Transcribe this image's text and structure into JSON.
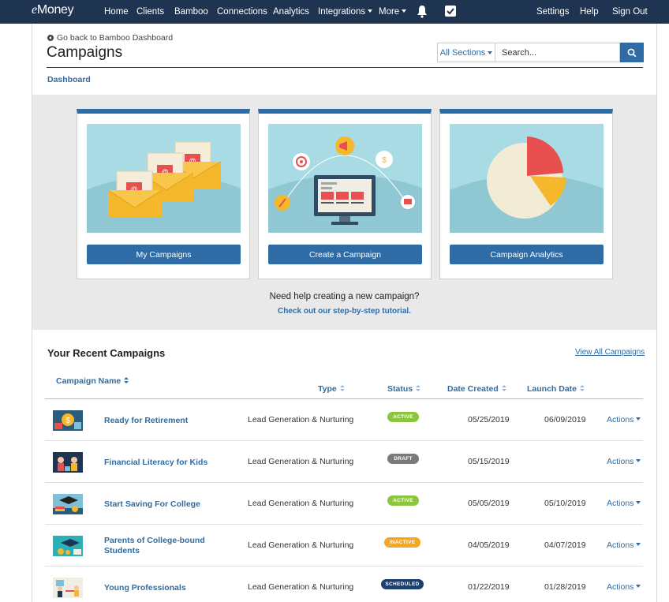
{
  "nav": {
    "logo_prefix": "e",
    "logo_rest": "Money",
    "items": [
      "Home",
      "Clients",
      "Bamboo",
      "Connections",
      "Analytics",
      "Integrations",
      "More"
    ],
    "right_items": [
      "Settings",
      "Help",
      "Sign Out"
    ],
    "bell_icon": "bell-icon",
    "check_icon": "checkbox-icon"
  },
  "header": {
    "back_link": "Go back to Bamboo Dashboard",
    "title": "Campaigns",
    "sections_label": "All Sections",
    "search_placeholder": "Search...",
    "breadcrumb": "Dashboard"
  },
  "cards": [
    {
      "button": "My Campaigns",
      "icon": "envelopes-illustration"
    },
    {
      "button": "Create a Campaign",
      "icon": "computer-illustration"
    },
    {
      "button": "Campaign Analytics",
      "icon": "pie-chart-illustration"
    }
  ],
  "help": {
    "text": "Need help creating a new campaign?",
    "link": "Check out our step-by-step tutorial."
  },
  "recent": {
    "title": "Your Recent Campaigns",
    "view_all": "View All Campaigns",
    "columns": {
      "name": "Campaign Name",
      "type": "Type",
      "status": "Status",
      "created": "Date Created",
      "launch": "Launch Date"
    },
    "rows": [
      {
        "name": "Ready for Retirement",
        "type": "Lead Generation & Nurturing",
        "status": "ACTIVE",
        "created": "05/25/2019",
        "launch": "06/09/2019",
        "actions": "Actions"
      },
      {
        "name": "Financial Literacy for Kids",
        "type": "Lead Generation & Nurturing",
        "status": "DRAFT",
        "created": "05/15/2019",
        "launch": "",
        "actions": "Actions"
      },
      {
        "name": "Start Saving For College",
        "type": "Lead Generation & Nurturing",
        "status": "ACTIVE",
        "created": "05/05/2019",
        "launch": "05/10/2019",
        "actions": "Actions"
      },
      {
        "name": "Parents of College-bound Students",
        "type": "Lead Generation & Nurturing",
        "status": "INACTIVE",
        "created": "04/05/2019",
        "launch": "04/07/2019",
        "actions": "Actions"
      },
      {
        "name": "Young Professionals",
        "type": "Lead Generation & Nurturing",
        "status": "SCHEDULED",
        "created": "01/22/2019",
        "launch": "01/28/2019",
        "actions": "Actions"
      }
    ]
  },
  "colors": {
    "nav_bg": "#1f3450",
    "accent": "#2f6ca5",
    "active": "#8cc63f",
    "draft": "#7a7a7a",
    "inactive": "#f5a623",
    "scheduled": "#1f3f6e"
  }
}
